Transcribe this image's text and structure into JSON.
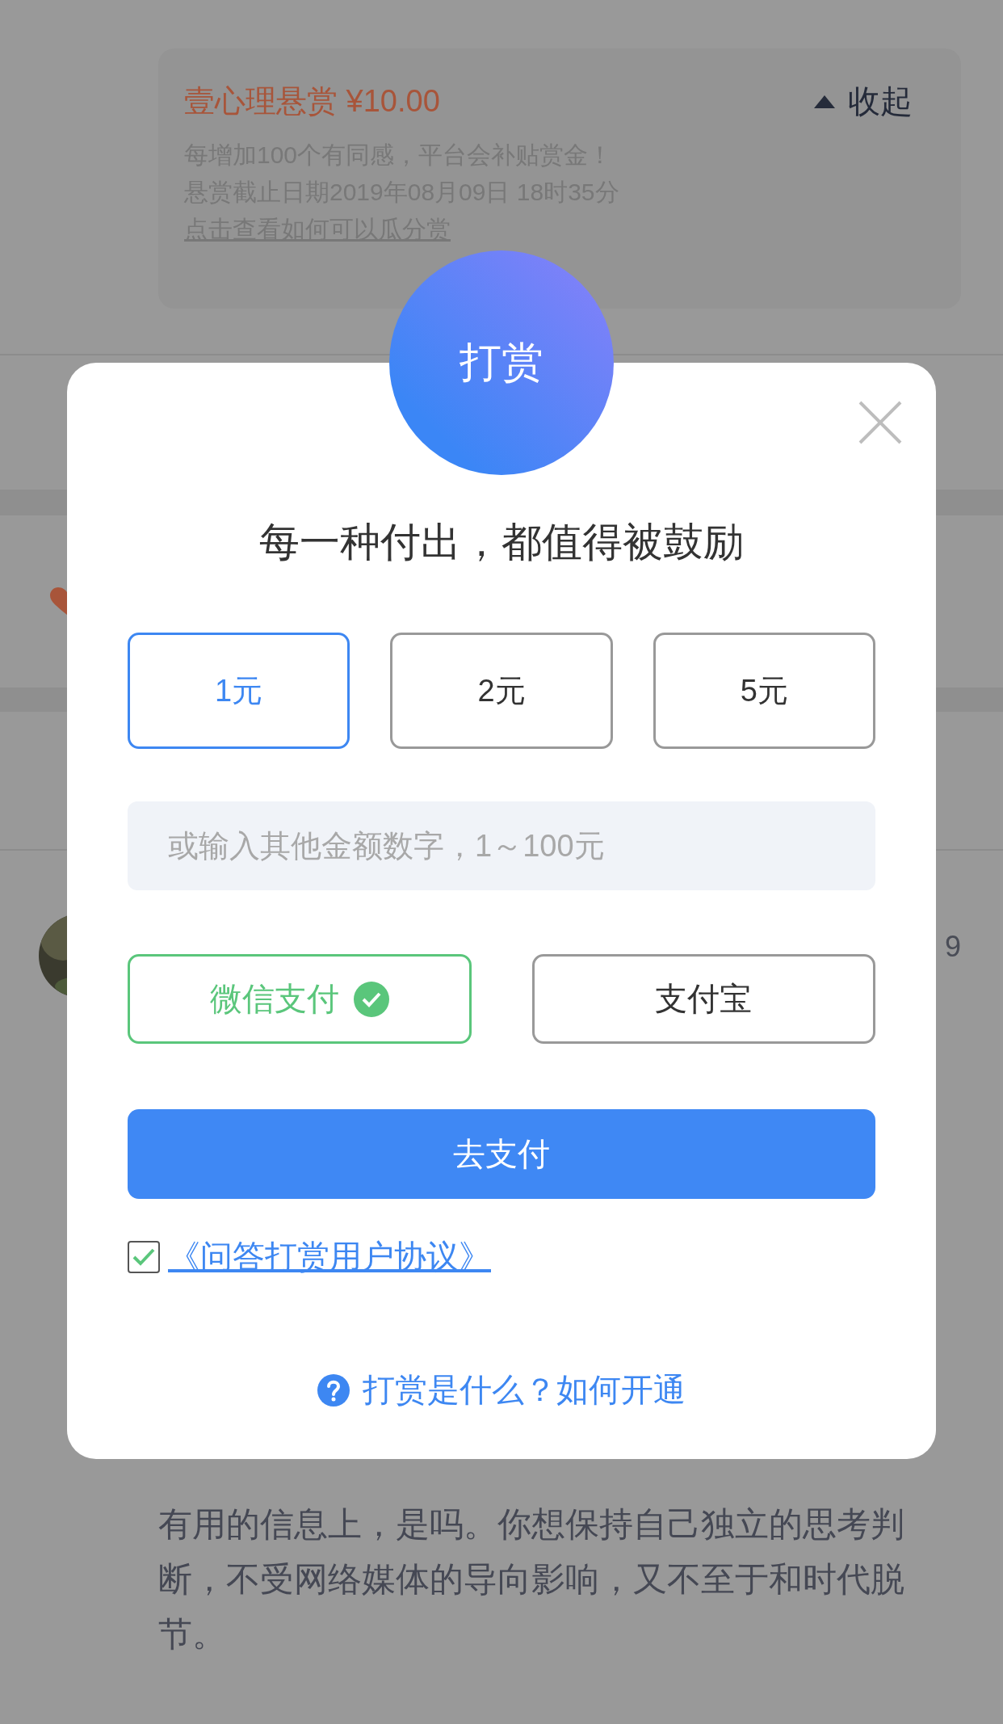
{
  "background": {
    "bounty": {
      "title": "壹心理悬赏 ¥10.00",
      "collapse": "收起",
      "lines": [
        "每增加100个有同感，平台会补贴赏金！",
        "悬赏截止日期2019年08月09日 18时35分"
      ],
      "link": "点击查看如何可以瓜分赏"
    },
    "answer_count": "9",
    "answer_lines": [
      "有用的信息上，是吗。你想保持自己独立的思考判",
      "断，不受网络媒体的导向影响，又不至于和时代脱",
      "节。"
    ]
  },
  "modal": {
    "badge": "打赏",
    "headline": "每一种付出，都值得被鼓励",
    "amounts": [
      {
        "label": "1元",
        "selected": true
      },
      {
        "label": "2元",
        "selected": false
      },
      {
        "label": "5元",
        "selected": false
      }
    ],
    "amount_input": {
      "placeholder": "或输入其他金额数字，1～100元"
    },
    "payments": [
      {
        "label": "微信支付",
        "selected": true
      },
      {
        "label": "支付宝",
        "selected": false
      }
    ],
    "pay_button": "去支付",
    "agreement": {
      "checked": true,
      "link": "《问答打赏用户协议》"
    },
    "help": "打赏是什么？如何开通"
  }
}
